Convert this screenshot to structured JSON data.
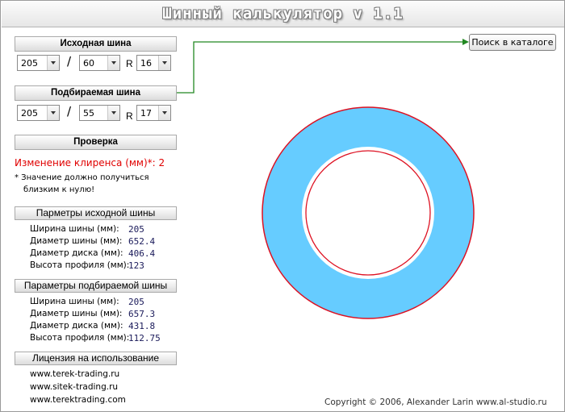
{
  "app": {
    "title": "Шинный калькулятор v 1.1"
  },
  "source_tire": {
    "header": "Исходная шина",
    "width": "205",
    "profile": "60",
    "rim": "16",
    "separator": "/",
    "r_label": "R"
  },
  "target_tire": {
    "header": "Подбираемая шина",
    "width": "205",
    "profile": "55",
    "rim": "17",
    "separator": "/",
    "r_label": "R"
  },
  "check": {
    "header": "Проверка",
    "clearance_label": "Изменение клиренса (мм)*:",
    "clearance_value": "2",
    "note_line1": "* Значение должно получиться",
    "note_line2": "близким к нулю!"
  },
  "source_params": {
    "header": "Парметры исходной шины",
    "rows": [
      {
        "label": "Ширина шины (мм):",
        "value": "205"
      },
      {
        "label": "Диаметр шины (мм):",
        "value": "652.4"
      },
      {
        "label": "Диаметр диска (мм):",
        "value": "406.4"
      },
      {
        "label": "Высота профиля (мм):",
        "value": "123"
      }
    ]
  },
  "target_params": {
    "header": "Параметры подбираемой шины",
    "rows": [
      {
        "label": "Ширина шины (мм):",
        "value": "205"
      },
      {
        "label": "Диаметр шины (мм):",
        "value": "657.3"
      },
      {
        "label": "Диаметр диска (мм):",
        "value": "431.8"
      },
      {
        "label": "Высота профиля (мм):",
        "value": "112.75"
      }
    ]
  },
  "license": {
    "header": "Лицензия на использование",
    "sites": [
      "www.terek-trading.ru",
      "www.sitek-trading.ru",
      "www.terektrading.com"
    ]
  },
  "search_button": "Поиск в каталоге",
  "copyright": "Copyright © 2006, Alexander Larin www.al-studio.ru",
  "colors": {
    "tire_fill": "#66ccff",
    "outline": "#dd1122",
    "connector": "#228822"
  }
}
